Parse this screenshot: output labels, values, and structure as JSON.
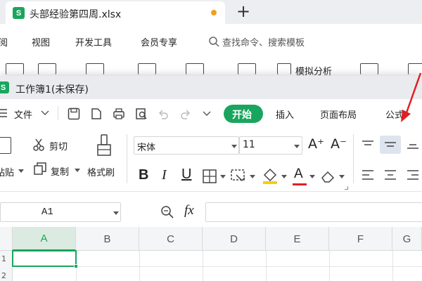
{
  "back_window": {
    "tab_title": "头部经验第四周.xlsx",
    "tab_icon_letter": "S",
    "menu_items": [
      "阅",
      "视图",
      "开发工具",
      "会员专享"
    ],
    "search_placeholder": "查找命令、搜索模板",
    "toolbar_label": "模拟分析"
  },
  "front_window": {
    "icon_letter": "S",
    "title": "工作簿1(未保存)",
    "file_menu": "文件",
    "tabs": [
      "开始",
      "插入",
      "页面布局",
      "公式"
    ],
    "active_tab": "开始",
    "clipboard": {
      "paste": "粘贴",
      "cut": "剪切",
      "copy": "复制",
      "format_painter": "格式刷"
    },
    "font": {
      "name": "宋体",
      "size": "11",
      "bold": "B",
      "italic": "I",
      "underline": "U",
      "color_glyph": "A",
      "accent_red": "#e02020",
      "highlight_yellow": "#f5d100"
    },
    "formula_bar": {
      "name_box": "A1",
      "fx": "fx"
    },
    "columns": [
      "A",
      "B",
      "C",
      "D",
      "E",
      "F",
      "G"
    ],
    "rows": [
      "1",
      "2"
    ],
    "selected_cell": "A1",
    "accent_green": "#1aa55e"
  }
}
